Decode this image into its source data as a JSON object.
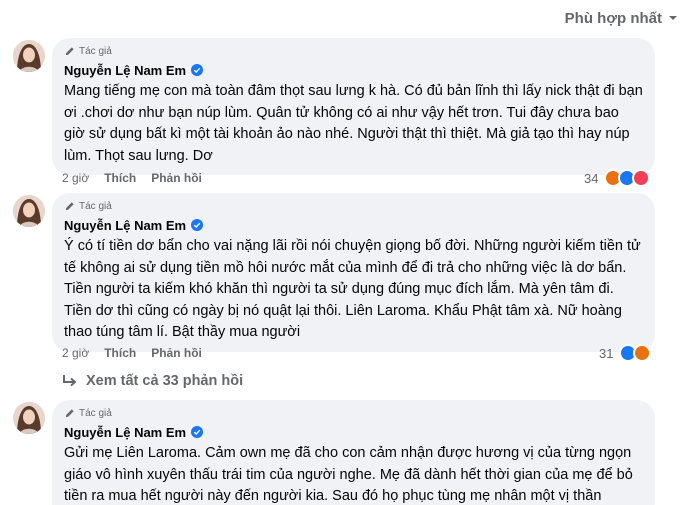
{
  "sort": {
    "label": "Phù hợp nhất"
  },
  "comments": [
    {
      "badge": "Tác giả",
      "name": "Nguyễn Lệ Nam Em",
      "text": "Mang tiếng mẹ con mà toàn đâm thọt sau lưng k hà. Có đủ bản lĩnh thì lấy nick thật đi bạn ơi .chơi dơ như bạn núp lùm. Quân tử không có ai như vậy hết trơn. Tui đây chưa bao giờ sử dụng bất kì một tài khoản ảo nào nhé. Người thật thì thiệt. Mà giả tạo thì hay núp lùm. Thọt sau lưng. Dơ",
      "time": "2 giờ",
      "like": "Thích",
      "reply": "Phản hồi",
      "reaction_count": "34",
      "reaction_icons": [
        "angry-react-icon",
        "like-react-icon",
        "love-react-icon"
      ]
    },
    {
      "badge": "Tác giả",
      "name": "Nguyễn Lệ Nam Em",
      "text": "Ý có tí tiền dơ bẩn cho vai nặng lãi rồi nói chuyện giọng bố đời. Những người kiếm tiền tử tế không ai sử dụng tiền mồ hôi nước mắt của mình để đi trả cho những việc là dơ bẩn. Tiền người ta kiếm khó khăn thì người ta sử dụng đúng mục đích lắm. Mà yên tâm đi. Tiền dơ thì cũng có ngày bị nó quật lại thôi. Liên Laroma. Khẩu Phật tâm xà. Nữ hoàng thao túng tâm lí. Bật thầy mua người",
      "time": "2 giờ",
      "like": "Thích",
      "reply": "Phản hồi",
      "reaction_count": "31",
      "reaction_icons": [
        "like-react-icon",
        "angry-react-icon"
      ]
    },
    {
      "badge": "Tác giả",
      "name": "Nguyễn Lệ Nam Em",
      "text": "Gửi mẹ Liên Laroma. Cảm own mẹ đã cho con cảm nhận được hương vị của từng ngọn giáo vô hình xuyên thấu trái tim của người nghe. Mẹ đã dành hết thời gian của mẹ để bỏ tiền ra mua hết người này đến người kia. Sau đó họ phục tùng mẹ nhân một vị thần"
    }
  ],
  "view_more": {
    "label": "Xem tất cả 33 phản hồi"
  },
  "colors": {
    "like": "#1877f2",
    "love": "#f33e58",
    "angry": "#e9710f",
    "bubble": "#f0f2f5",
    "muted": "#65676b",
    "verified": "#1877f2"
  }
}
